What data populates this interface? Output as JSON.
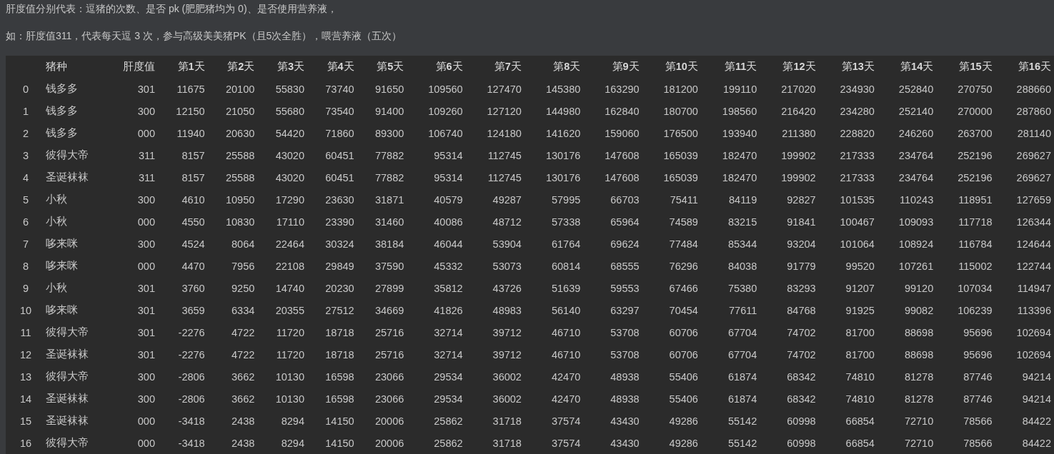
{
  "notes": [
    "肝度值分别代表：逗猪的次数、是否 pk (肥肥猪均为 0)、是否使用营养液，",
    "如：肝度值311，代表每天逗 3 次，参与高级美美猪PK（且5次全胜），喂营养液（五次）"
  ],
  "table": {
    "columns": [
      "猪种",
      "肝度值",
      "第**1**天",
      "第**2**天",
      "第**3**天",
      "第**4**天",
      "第**5**天",
      "第**6**天",
      "第**7**天",
      "第**8**天",
      "第**9**天",
      "第**10**天",
      "第**11**天",
      "第**12**天",
      "第**13**天",
      "第**14**天",
      "第**15**天",
      "第**16**天"
    ],
    "rows": [
      {
        "index": "0",
        "cells": [
          "钱多多",
          "301",
          "11675",
          "20100",
          "55830",
          "73740",
          "91650",
          "109560",
          "127470",
          "145380",
          "163290",
          "181200",
          "199110",
          "217020",
          "234930",
          "252840",
          "270750",
          "288660"
        ]
      },
      {
        "index": "1",
        "cells": [
          "钱多多",
          "300",
          "12150",
          "21050",
          "55680",
          "73540",
          "91400",
          "109260",
          "127120",
          "144980",
          "162840",
          "180700",
          "198560",
          "216420",
          "234280",
          "252140",
          "270000",
          "287860"
        ]
      },
      {
        "index": "2",
        "cells": [
          "钱多多",
          "000",
          "11940",
          "20630",
          "54420",
          "71860",
          "89300",
          "106740",
          "124180",
          "141620",
          "159060",
          "176500",
          "193940",
          "211380",
          "228820",
          "246260",
          "263700",
          "281140"
        ]
      },
      {
        "index": "3",
        "cells": [
          "彼得大帝",
          "311",
          "8157",
          "25588",
          "43020",
          "60451",
          "77882",
          "95314",
          "112745",
          "130176",
          "147608",
          "165039",
          "182470",
          "199902",
          "217333",
          "234764",
          "252196",
          "269627"
        ]
      },
      {
        "index": "4",
        "cells": [
          "圣诞袜袜",
          "311",
          "8157",
          "25588",
          "43020",
          "60451",
          "77882",
          "95314",
          "112745",
          "130176",
          "147608",
          "165039",
          "182470",
          "199902",
          "217333",
          "234764",
          "252196",
          "269627"
        ]
      },
      {
        "index": "5",
        "cells": [
          "小秋",
          "300",
          "4610",
          "10950",
          "17290",
          "23630",
          "31871",
          "40579",
          "49287",
          "57995",
          "66703",
          "75411",
          "84119",
          "92827",
          "101535",
          "110243",
          "118951",
          "127659"
        ]
      },
      {
        "index": "6",
        "cells": [
          "小秋",
          "000",
          "4550",
          "10830",
          "17110",
          "23390",
          "31460",
          "40086",
          "48712",
          "57338",
          "65964",
          "74589",
          "83215",
          "91841",
          "100467",
          "109093",
          "117718",
          "126344"
        ]
      },
      {
        "index": "7",
        "cells": [
          "哆来咪",
          "300",
          "4524",
          "8064",
          "22464",
          "30324",
          "38184",
          "46044",
          "53904",
          "61764",
          "69624",
          "77484",
          "85344",
          "93204",
          "101064",
          "108924",
          "116784",
          "124644"
        ]
      },
      {
        "index": "8",
        "cells": [
          "哆来咪",
          "000",
          "4470",
          "7956",
          "22108",
          "29849",
          "37590",
          "45332",
          "53073",
          "60814",
          "68555",
          "76296",
          "84038",
          "91779",
          "99520",
          "107261",
          "115002",
          "122744"
        ]
      },
      {
        "index": "9",
        "cells": [
          "小秋",
          "301",
          "3760",
          "9250",
          "14740",
          "20230",
          "27899",
          "35812",
          "43726",
          "51639",
          "59553",
          "67466",
          "75380",
          "83293",
          "91207",
          "99120",
          "107034",
          "114947"
        ]
      },
      {
        "index": "10",
        "cells": [
          "哆来咪",
          "301",
          "3659",
          "6334",
          "20355",
          "27512",
          "34669",
          "41826",
          "48983",
          "56140",
          "63297",
          "70454",
          "77611",
          "84768",
          "91925",
          "99082",
          "106239",
          "113396"
        ]
      },
      {
        "index": "11",
        "cells": [
          "彼得大帝",
          "301",
          "-2276",
          "4722",
          "11720",
          "18718",
          "25716",
          "32714",
          "39712",
          "46710",
          "53708",
          "60706",
          "67704",
          "74702",
          "81700",
          "88698",
          "95696",
          "102694"
        ]
      },
      {
        "index": "12",
        "cells": [
          "圣诞袜袜",
          "301",
          "-2276",
          "4722",
          "11720",
          "18718",
          "25716",
          "32714",
          "39712",
          "46710",
          "53708",
          "60706",
          "67704",
          "74702",
          "81700",
          "88698",
          "95696",
          "102694"
        ]
      },
      {
        "index": "13",
        "cells": [
          "彼得大帝",
          "300",
          "-2806",
          "3662",
          "10130",
          "16598",
          "23066",
          "29534",
          "36002",
          "42470",
          "48938",
          "55406",
          "61874",
          "68342",
          "74810",
          "81278",
          "87746",
          "94214"
        ]
      },
      {
        "index": "14",
        "cells": [
          "圣诞袜袜",
          "300",
          "-2806",
          "3662",
          "10130",
          "16598",
          "23066",
          "29534",
          "36002",
          "42470",
          "48938",
          "55406",
          "61874",
          "68342",
          "74810",
          "81278",
          "87746",
          "94214"
        ]
      },
      {
        "index": "15",
        "cells": [
          "圣诞袜袜",
          "000",
          "-3418",
          "2438",
          "8294",
          "14150",
          "20006",
          "25862",
          "31718",
          "37574",
          "43430",
          "49286",
          "55142",
          "60998",
          "66854",
          "72710",
          "78566",
          "84422"
        ]
      },
      {
        "index": "16",
        "cells": [
          "彼得大帝",
          "000",
          "-3418",
          "2438",
          "8294",
          "14150",
          "20006",
          "25862",
          "31718",
          "37574",
          "43430",
          "49286",
          "55142",
          "60998",
          "66854",
          "72710",
          "78566",
          "84422"
        ]
      }
    ]
  }
}
